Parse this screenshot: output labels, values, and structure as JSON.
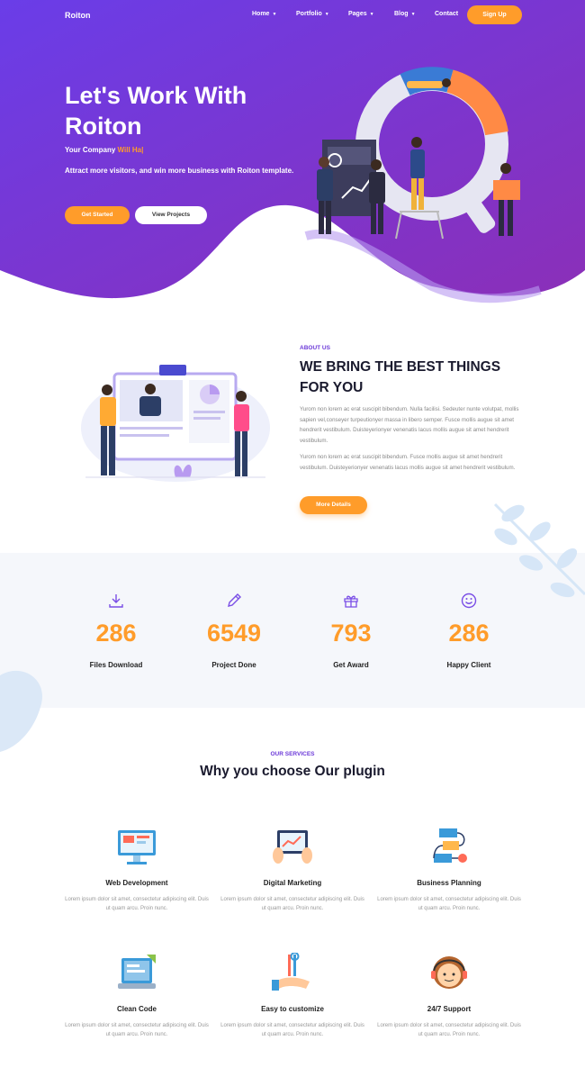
{
  "nav": {
    "logo": "Roiton",
    "items": [
      {
        "label": "Home",
        "dropdown": true
      },
      {
        "label": "Portfolio",
        "dropdown": true
      },
      {
        "label": "Pages",
        "dropdown": true
      },
      {
        "label": "Blog",
        "dropdown": true
      },
      {
        "label": "Contact",
        "dropdown": false
      }
    ],
    "signup": "Sign Up"
  },
  "hero": {
    "title": "Let's Work With Roiton",
    "company_prefix": "Your Company ",
    "company_accent": "Will Ha|",
    "description": "Attract more visitors, and win more business with Roiton template.",
    "btn_start": "Get Started",
    "btn_projects": "View Projects"
  },
  "about": {
    "tag": "ABOUT US",
    "title": "WE BRING THE BEST THINGS FOR YOU",
    "p1": "Yurom non lorem ac erat suscipit bibendum. Nulla facilisi. Sedeuter nunte volutpat, mollis sapien vel,conseyer turpeutionyer massa in libero semper. Fusce mollis augue sit amet hendrerit vestibulum. Duisteyerionyer venenatis lacus mollis augue sit amet hendrerit vestibulum.",
    "p2": "Yurom non lorem ac erat suscipit bibendum. Fusce mollis augue sit amet hendrerit vestibulum. Duisteyerionyer venenatis lacus mollis augue sit amet hendrerit vestibulum.",
    "btn_more": "More Details"
  },
  "stats": [
    {
      "icon": "download-icon",
      "value": "286",
      "label": "Files Download"
    },
    {
      "icon": "pencil-icon",
      "value": "6549",
      "label": "Project Done"
    },
    {
      "icon": "gift-icon",
      "value": "793",
      "label": "Get Award"
    },
    {
      "icon": "smile-icon",
      "value": "286",
      "label": "Happy Client"
    }
  ],
  "services": {
    "tag": "OUR SERVICES",
    "title": "Why you choose Our plugin",
    "items": [
      {
        "icon": "monitor-icon",
        "name": "Web Development",
        "desc": "Lorem ipsum dolor sit amet, consectetur adipiscing elit. Duis ut quam arcu. Proin nunc."
      },
      {
        "icon": "tablet-chart-icon",
        "name": "Digital Marketing",
        "desc": "Lorem ipsum dolor sit amet, consectetur adipiscing elit. Duis ut quam arcu. Proin nunc."
      },
      {
        "icon": "flowchart-icon",
        "name": "Business Planning",
        "desc": "Lorem ipsum dolor sit amet, consectetur adipiscing elit. Duis ut quam arcu. Proin nunc."
      },
      {
        "icon": "code-laptop-icon",
        "name": "Clean Code",
        "desc": "Lorem ipsum dolor sit amet, consectetur adipiscing elit. Duis ut quam arcu. Proin nunc."
      },
      {
        "icon": "tools-hand-icon",
        "name": "Easy to customize",
        "desc": "Lorem ipsum dolor sit amet, consectetur adipiscing elit. Duis ut quam arcu. Proin nunc."
      },
      {
        "icon": "support-agent-icon",
        "name": "24/7 Support",
        "desc": "Lorem ipsum dolor sit amet, consectetur adipiscing elit. Duis ut quam arcu. Proin nunc."
      }
    ]
  },
  "colors": {
    "accent": "#ff9c2a",
    "purple_start": "#6a3de8",
    "purple_end": "#8b2fb8",
    "tag_purple": "#6c3ad8"
  }
}
